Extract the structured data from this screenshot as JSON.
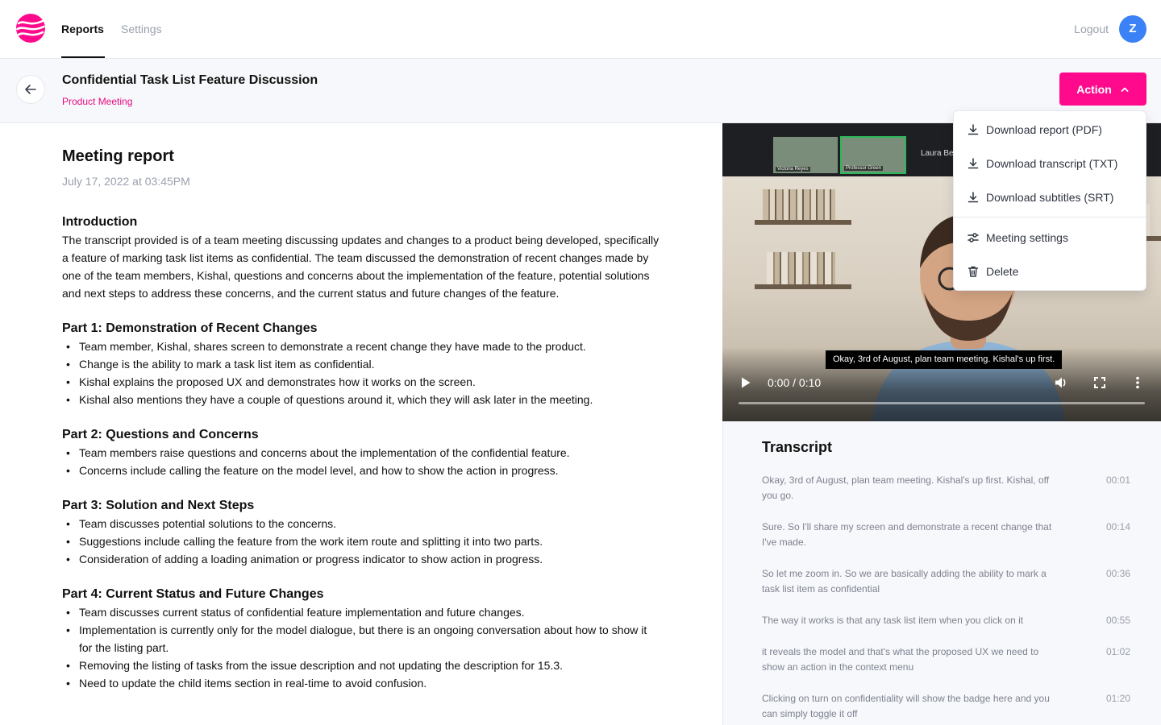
{
  "nav": {
    "tabs": [
      {
        "label": "Reports",
        "active": true
      },
      {
        "label": "Settings",
        "active": false
      }
    ],
    "logout_label": "Logout",
    "avatar_initial": "Z"
  },
  "meeting": {
    "title": "Confidential Task List Feature Discussion",
    "type": "Product Meeting",
    "action_label": "Action"
  },
  "report": {
    "heading": "Meeting report",
    "date": "July 17, 2022 at 03:45PM",
    "sections": [
      {
        "title": "Introduction",
        "paragraph": "The transcript provided is of a team meeting discussing updates and changes to a product being developed, specifically a feature of marking task list items as confidential. The team discussed the demonstration of recent changes made by one of the team members, Kishal, questions and concerns about the implementation of the feature, potential solutions and next steps to address these concerns, and the current status and future changes of the feature."
      },
      {
        "title": "Part 1: Demonstration of Recent Changes",
        "bullets": [
          "Team member, Kishal, shares screen to demonstrate a recent change they have made to the product.",
          "Change is the ability to mark a task list item as confidential.",
          "Kishal explains the proposed UX and demonstrates how it works on the screen.",
          "Kishal also mentions they have a couple of questions around it, which they will ask later in the meeting."
        ]
      },
      {
        "title": "Part 2: Questions and Concerns",
        "bullets": [
          "Team members raise questions and concerns about the implementation of the confidential feature.",
          "Concerns include calling the feature on the model level, and how to show the action in progress."
        ]
      },
      {
        "title": "Part 3: Solution and Next Steps",
        "bullets": [
          "Team discusses potential solutions to the concerns.",
          "Suggestions include calling the feature from the work item route and splitting it into two parts.",
          "Consideration of adding a loading animation or progress indicator to show action in progress."
        ]
      },
      {
        "title": "Part 4: Current Status and Future Changes",
        "bullets": [
          "Team discusses current status of confidential feature implementation and future changes.",
          "Implementation is currently only for the model dialogue, but there is an ongoing conversation about how to show it for the listing part.",
          "Removing the listing of tasks from the issue description and not updating the description for 15.3.",
          "Need to update the child items section in real-time to avoid confusion."
        ]
      }
    ]
  },
  "video": {
    "caption": "Okay, 3rd of August, plan team meeting. Kishal's up first.",
    "timecode": "0:00 / 0:10",
    "progress": 0,
    "participants": [
      "Victoria Reyes",
      "Professor Green"
    ],
    "speaker_label": "Laura Be"
  },
  "transcript": {
    "title": "Transcript",
    "entries": [
      {
        "text": "Okay, 3rd of August, plan team meeting. Kishal's up first. Kishal, off you go.",
        "time": "00:01"
      },
      {
        "text": "Sure. So I'll share my screen and demonstrate a recent change that I've made.",
        "time": "00:14"
      },
      {
        "text": "So let me zoom in. So we are basically adding the ability to mark a task list item as confidential",
        "time": "00:36"
      },
      {
        "text": "The way it works is that any task list item when you click on it",
        "time": "00:55"
      },
      {
        "text": "it reveals the model and that's what the proposed UX we need to show an action in the context menu",
        "time": "01:02"
      },
      {
        "text": "Clicking on turn on confidentiality will show the badge here and you can simply toggle it off",
        "time": "01:20"
      }
    ]
  },
  "action_menu": {
    "items": [
      {
        "label": "Download report (PDF)",
        "icon": "download-icon"
      },
      {
        "label": "Download transcript (TXT)",
        "icon": "download-icon"
      },
      {
        "label": "Download subtitles (SRT)",
        "icon": "download-icon"
      },
      {
        "label": "Meeting settings",
        "icon": "sliders-icon"
      },
      {
        "label": "Delete",
        "icon": "trash-icon"
      }
    ]
  },
  "colors": {
    "brand": "#ff0a8c",
    "avatar": "#3b82f6",
    "muted_text": "#9aa0ac"
  }
}
